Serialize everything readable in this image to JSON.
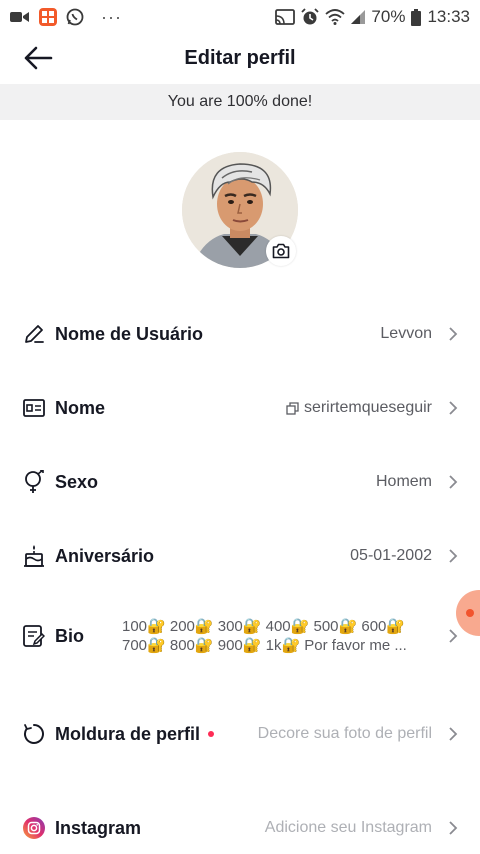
{
  "status_bar": {
    "app_icons": [
      "video-camera-icon",
      "grid-app-icon",
      "whatsapp-icon"
    ],
    "more": "···",
    "battery": "70%",
    "time": "13:33"
  },
  "header": {
    "title": "Editar perfil"
  },
  "banner": {
    "text": "You are 100% done!"
  },
  "profile": {
    "rows": [
      {
        "icon": "pencil-icon",
        "label": "Nome de Usuário",
        "value": "Levvon"
      },
      {
        "icon": "id-card-icon",
        "label": "Nome",
        "value": "serirtemqueseguir",
        "value_icon": "copy-icon"
      },
      {
        "icon": "gender-icon",
        "label": "Sexo",
        "value": "Homem"
      },
      {
        "icon": "cake-icon",
        "label": "Aniversário",
        "value": "05-01-2002"
      },
      {
        "icon": "bio-edit-icon",
        "label": "Bio",
        "value_line1": "100🔐 200🔐 300🔐 400🔐 500🔐 600🔐",
        "value_line2": "700🔐 800🔐 900🔐 1k🔐 Por favor me ..."
      },
      {
        "icon": "frame-icon",
        "label": "Moldura de perfil",
        "value": "Decore sua foto de perfil",
        "badge": "red-dot"
      },
      {
        "icon": "instagram-icon",
        "label": "Instagram",
        "value": "Adicione seu Instagram"
      }
    ]
  },
  "colors": {
    "accent_red": "#fe2c55",
    "banner_bg": "#f1f1f2",
    "text_primary": "#161823",
    "text_secondary": "#5b5c62",
    "placeholder": "#aeb0b5"
  }
}
